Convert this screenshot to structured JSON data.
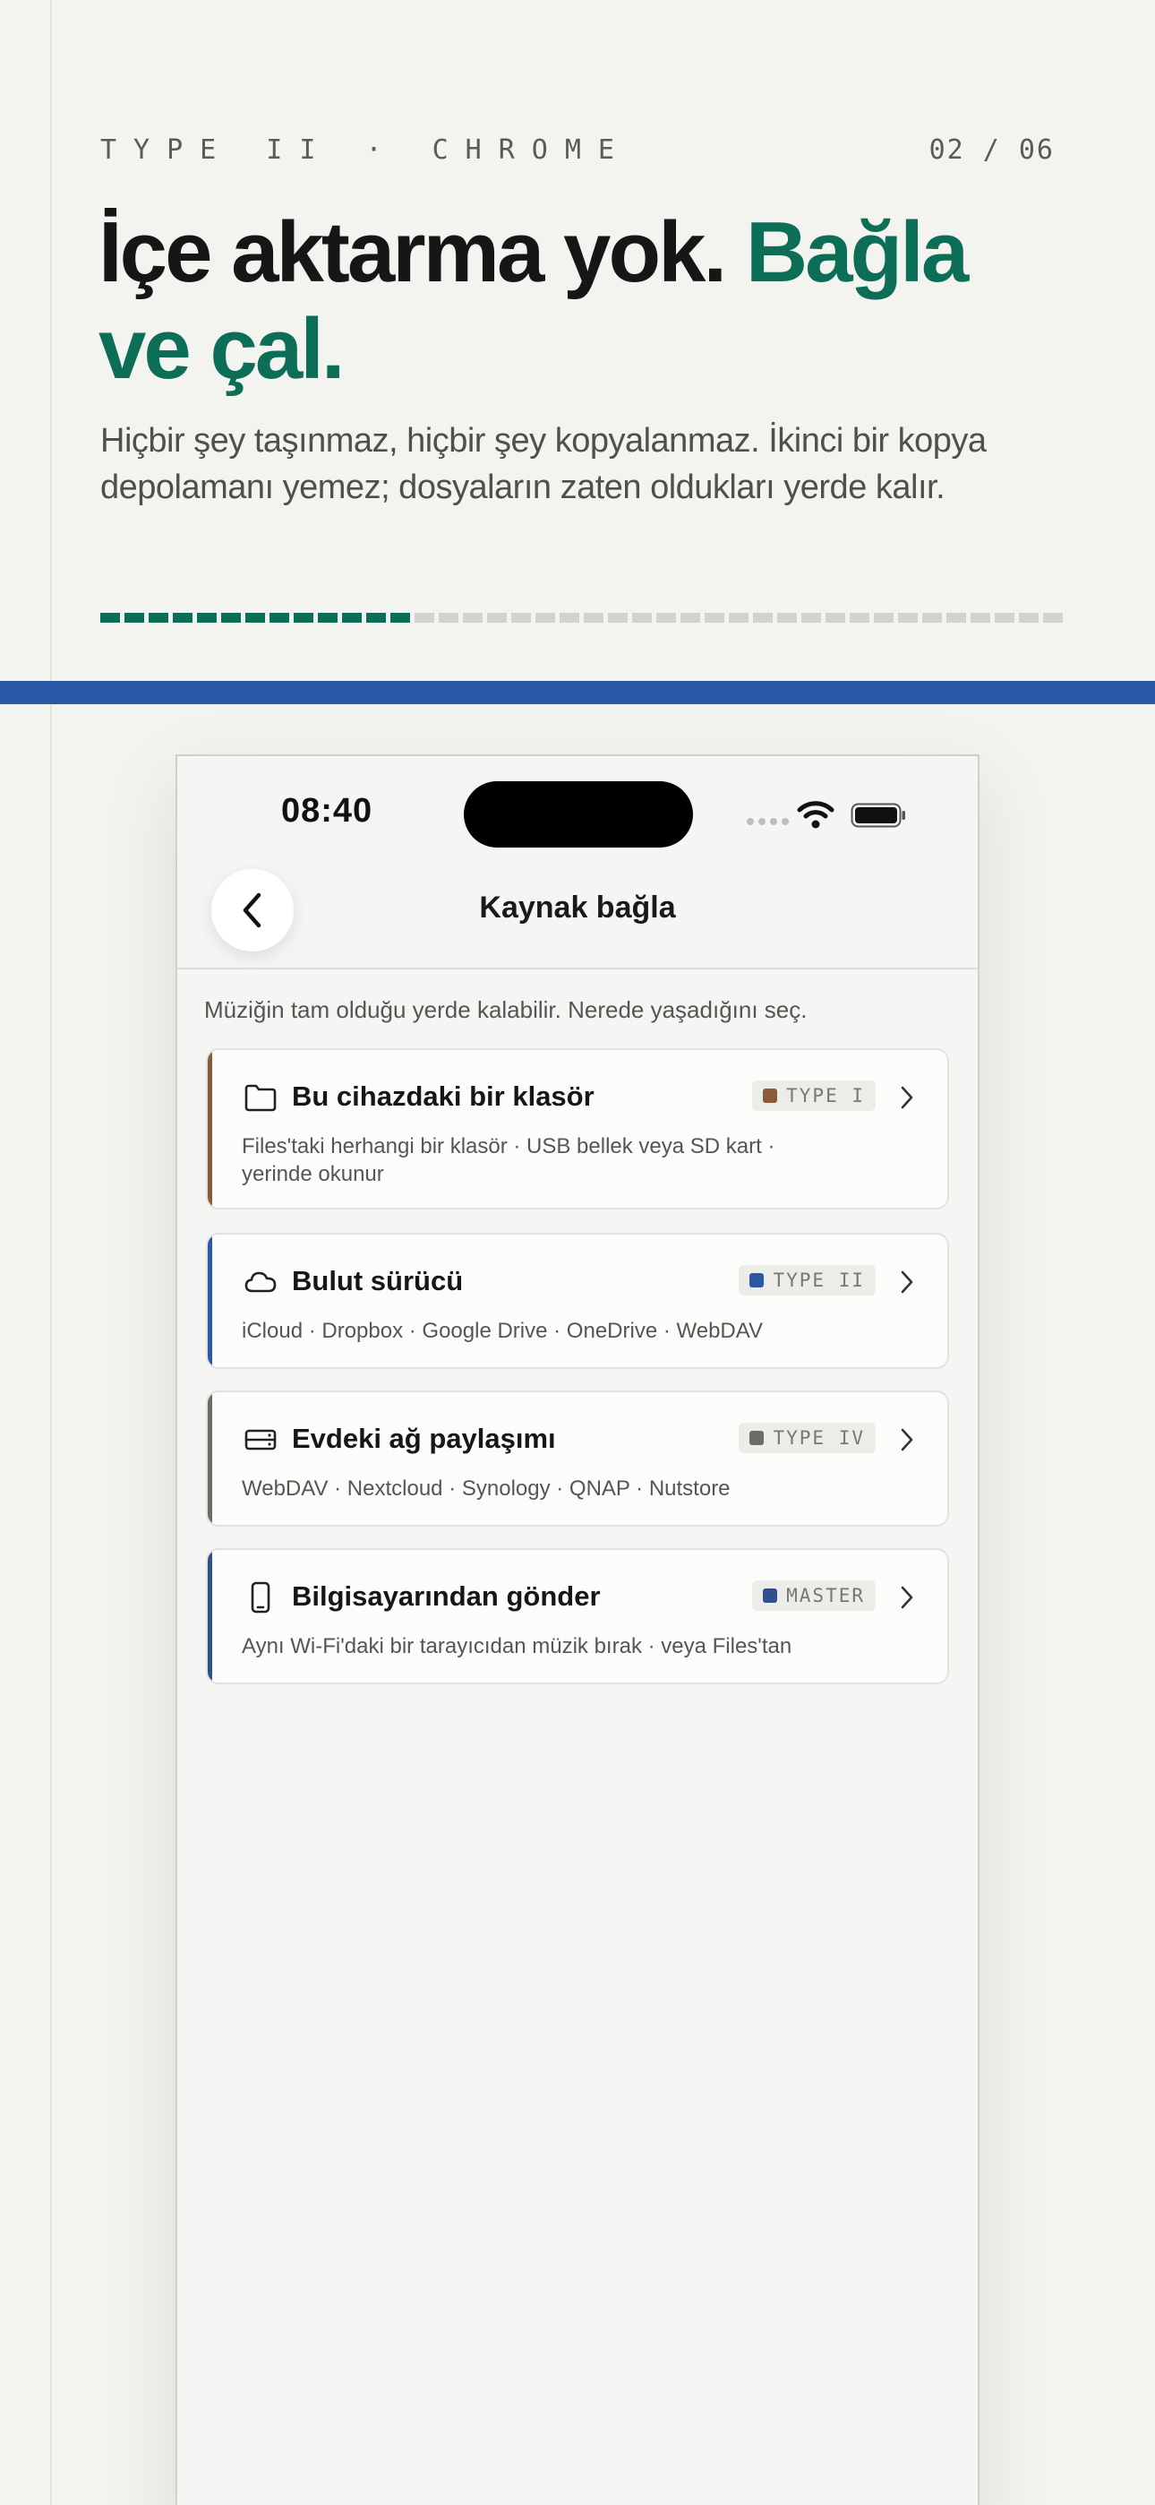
{
  "header": {
    "eyebrow": "TYPE II · CHROME",
    "pager": "02 / 06",
    "headline_main": "İçe aktarma yok. ",
    "headline_accent": "Bağla ve çal.",
    "subhead": "Hiçbir şey taşınmaz, hiçbir şey kopyalanmaz. İkinci bir kopya depolamanı yemez; dosyaların zaten oldukları yerde kalır."
  },
  "progress": {
    "filled": 13,
    "total": 40
  },
  "status_bar": {
    "time": "08:40"
  },
  "nav": {
    "title": "Kaynak bağla"
  },
  "intro": "Müziğin tam olduğu yerde kalabilir. Nerede yaşadığını seç.",
  "sources": [
    {
      "title": "Bu cihazdaki bir klasör",
      "badge": "TYPE I",
      "color": "#8a5a3a",
      "icon": "folder-icon",
      "desc": "Files'taki herhangi bir klasör · USB bellek veya SD kart · yerinde okunur"
    },
    {
      "title": "Bulut sürücü",
      "badge": "TYPE II",
      "color": "#2a57a6",
      "icon": "cloud-icon",
      "desc": "iCloud · Dropbox · Google Drive · OneDrive · WebDAV"
    },
    {
      "title": "Evdeki ağ paylaşımı",
      "badge": "TYPE IV",
      "color": "#6b6b68",
      "icon": "server-icon",
      "desc": "WebDAV · Nextcloud · Synology · QNAP · Nutstore"
    },
    {
      "title": "Bilgisayarından gönder",
      "badge": "MASTER",
      "color": "#2f4f8f",
      "icon": "phone-icon",
      "desc": "Aynı Wi-Fi'daki bir tarayıcıdan müzik bırak · veya Files'tan"
    }
  ],
  "colors": {
    "accent": "#0d6e57",
    "band": "#2a57a6",
    "background": "#f3f3ef"
  }
}
